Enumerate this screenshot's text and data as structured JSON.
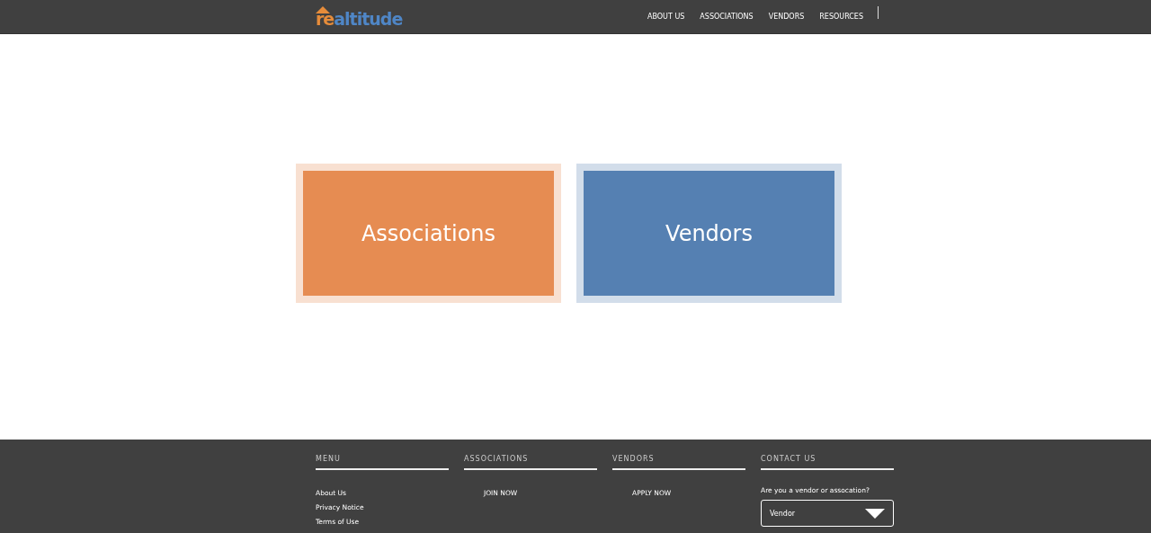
{
  "logo": {
    "accent": "re",
    "rest": "altitude"
  },
  "nav": [
    "ABOUT US",
    "ASSOCIATIONS",
    "VENDORS",
    "RESOURCES"
  ],
  "tiles": [
    {
      "label": "Associations",
      "color": "#e68c52"
    },
    {
      "label": "Vendors",
      "color": "#5580b2"
    }
  ],
  "footer": [
    {
      "kind": "links",
      "heading": "MENU",
      "items": [
        "About Us",
        "Privacy Notice",
        "Terms of Use"
      ]
    },
    {
      "kind": "action",
      "heading": "ASSOCIATIONS",
      "items": [
        "JOIN NOW"
      ]
    },
    {
      "kind": "action",
      "heading": "VENDORS",
      "items": [
        "APPLY NOW"
      ]
    },
    {
      "kind": "form",
      "heading": "CONTACT US",
      "question": "Are you a vendor or assocation?",
      "value": "Vendor"
    }
  ]
}
